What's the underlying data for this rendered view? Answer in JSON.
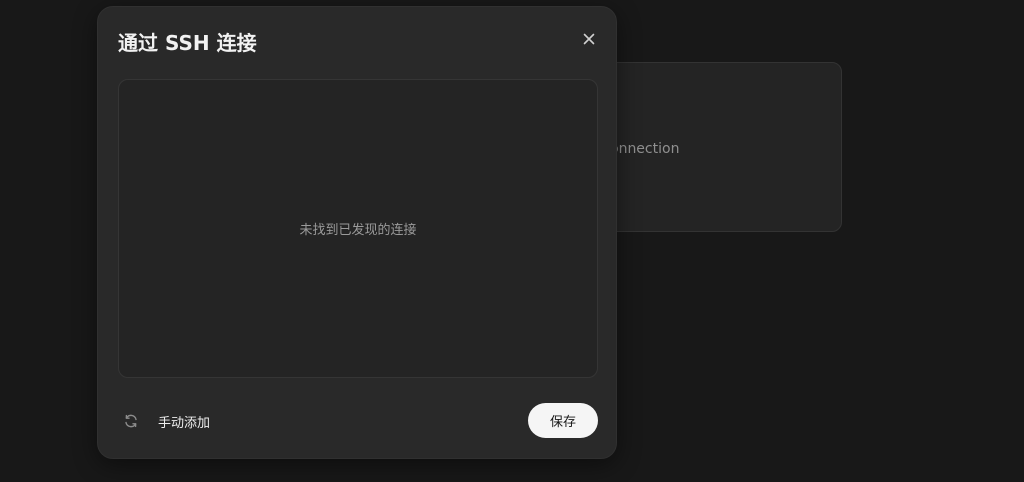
{
  "background": {
    "card_text": "onnection"
  },
  "dialog": {
    "title": "通过 SSH 连接",
    "close_icon": "close-icon",
    "empty_message": "未找到已发现的连接",
    "refresh_icon": "refresh-icon",
    "manual_add_label": "手动添加",
    "save_label": "保存"
  },
  "colors": {
    "page_background": "#181818",
    "dialog_background": "#292929",
    "primary_button": "#f5f5f5"
  }
}
